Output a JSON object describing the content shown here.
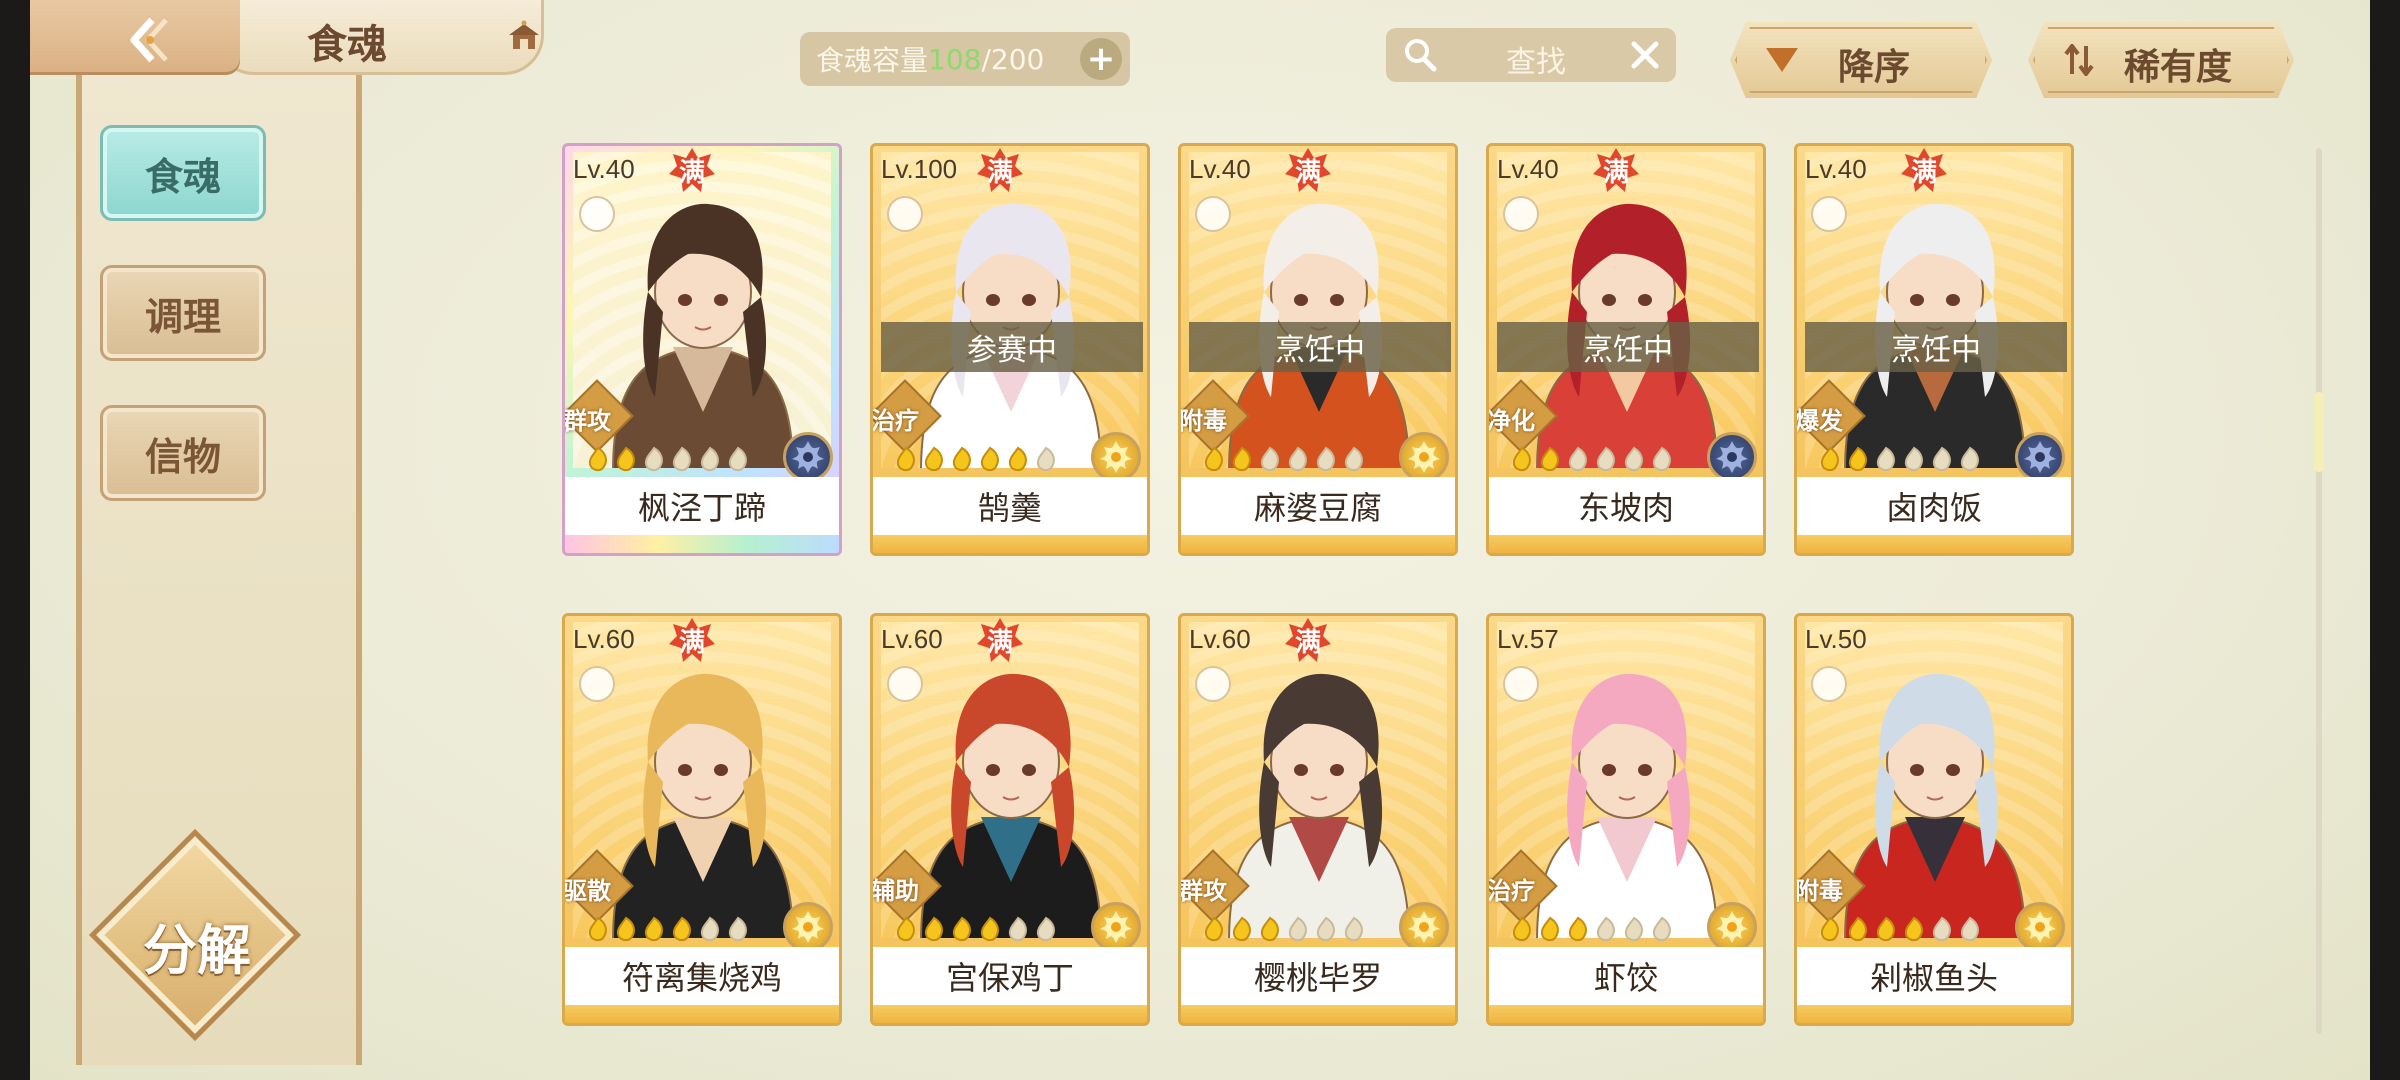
{
  "header": {
    "title": "食魂",
    "capacity_label": "食魂容量",
    "capacity_current": "108",
    "capacity_total": "/200",
    "search_label": "查找",
    "sort_order_label": "降序",
    "sort_by_label": "稀有度"
  },
  "sidebar": {
    "tabs": [
      {
        "label": "食魂",
        "active": true
      },
      {
        "label": "调理",
        "active": false
      },
      {
        "label": "信物",
        "active": false
      }
    ],
    "decompose_label": "分解"
  },
  "cards": [
    {
      "level": "Lv.40",
      "max": "满",
      "status": "",
      "role": "群攻",
      "name": "枫泾丁蹄",
      "stars_filled": 2,
      "element": "purple",
      "rainbow": true,
      "palette": [
        "#4a3325",
        "#6b4b34",
        "#d6b89a"
      ]
    },
    {
      "level": "Lv.100",
      "max": "满",
      "status": "参赛中",
      "role": "治疗",
      "name": "鹄羹",
      "stars_filled": 5,
      "element": "gold",
      "rainbow": false,
      "palette": [
        "#e9e6ef",
        "#ffffff",
        "#f1d3d9"
      ]
    },
    {
      "level": "Lv.40",
      "max": "满",
      "status": "烹饪中",
      "role": "附毒",
      "name": "麻婆豆腐",
      "stars_filled": 2,
      "element": "gold",
      "rainbow": false,
      "palette": [
        "#f3efe8",
        "#d4521e",
        "#2a2a2a"
      ]
    },
    {
      "level": "Lv.40",
      "max": "满",
      "status": "烹饪中",
      "role": "净化",
      "name": "东坡肉",
      "stars_filled": 2,
      "element": "purple",
      "rainbow": false,
      "palette": [
        "#b2202a",
        "#d94037",
        "#f2c9a0"
      ]
    },
    {
      "level": "Lv.40",
      "max": "满",
      "status": "烹饪中",
      "role": "爆发",
      "name": "卤肉饭",
      "stars_filled": 2,
      "element": "purple",
      "rainbow": false,
      "palette": [
        "#eeeeee",
        "#2a2a2a",
        "#b76a3d"
      ]
    },
    {
      "level": "Lv.60",
      "max": "满",
      "status": "",
      "role": "驱散",
      "name": "符离集烧鸡",
      "stars_filled": 4,
      "element": "gold",
      "rainbow": false,
      "palette": [
        "#e9b85a",
        "#222222",
        "#f1d2b0"
      ]
    },
    {
      "level": "Lv.60",
      "max": "满",
      "status": "",
      "role": "辅助",
      "name": "宫保鸡丁",
      "stars_filled": 4,
      "element": "gold",
      "rainbow": false,
      "palette": [
        "#c9472a",
        "#1c1c1c",
        "#2f6f88"
      ]
    },
    {
      "level": "Lv.60",
      "max": "满",
      "status": "",
      "role": "群攻",
      "name": "樱桃毕罗",
      "stars_filled": 3,
      "element": "gold",
      "rainbow": false,
      "palette": [
        "#4a3a34",
        "#f0f0e8",
        "#b14a46"
      ]
    },
    {
      "level": "Lv.57",
      "max": "",
      "status": "",
      "role": "治疗",
      "name": "虾饺",
      "stars_filled": 3,
      "element": "gold",
      "rainbow": false,
      "palette": [
        "#f5a9c0",
        "#ffffff",
        "#f3c9d0"
      ]
    },
    {
      "level": "Lv.50",
      "max": "",
      "status": "",
      "role": "附毒",
      "name": "剁椒鱼头",
      "stars_filled": 4,
      "element": "gold",
      "rainbow": false,
      "palette": [
        "#cfdbe6",
        "#c9261f",
        "#35303a"
      ]
    }
  ]
}
